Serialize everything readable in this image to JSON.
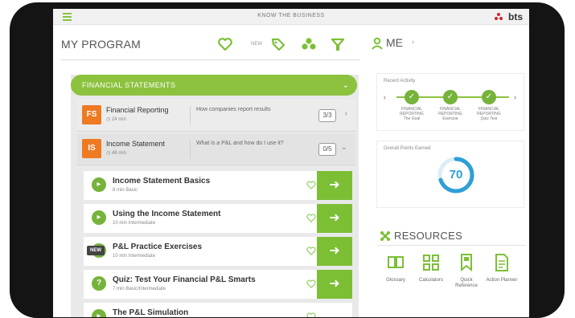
{
  "app": {
    "title": "KNOW THE BUSINESS",
    "brand": "bts"
  },
  "colors": {
    "accent": "#8cc23e",
    "accent_dark": "#76b33a",
    "topic_icon": "#ee7a22",
    "points": "#2f9fd6"
  },
  "program": {
    "title": "MY PROGRAM",
    "filter_new_label": "NEW",
    "section_label": "FINANCIAL STATEMENTS",
    "topics": [
      {
        "name": "Financial Reporting",
        "time": "24 min",
        "desc": "How companies report results",
        "count": "3/3",
        "icon": "FS"
      },
      {
        "name": "Income Statement",
        "time": "48 min",
        "desc": "What is a P&L and how do I use it?",
        "count": "0/5",
        "icon": "IS"
      }
    ],
    "lessons": [
      {
        "name": "Income Statement Basics",
        "meta": "8 min   Basic",
        "icon": "play-icon",
        "is_new": false
      },
      {
        "name": "Using the Income Statement",
        "meta": "10 min   Intermediate",
        "icon": "play-icon",
        "is_new": false
      },
      {
        "name": "P&L Practice Exercises",
        "meta": "10 min   Intermediate",
        "icon": "exercise-icon",
        "is_new": true,
        "new_label": "NEW"
      },
      {
        "name": "Quiz: Test Your Financial P&L Smarts",
        "meta": "7 min   Basic/Intermediate",
        "icon": "quiz-icon",
        "is_new": false
      },
      {
        "name": "The P&L Simulation",
        "meta": "",
        "icon": "play-icon",
        "is_new": false
      }
    ]
  },
  "me": {
    "label": "ME",
    "recent_activity_title": "Recent Activity",
    "activity": [
      {
        "label_line1": "FINANCIAL",
        "label_line2": "REPORTING",
        "label_line3": "The Goal"
      },
      {
        "label_line1": "FINANCIAL",
        "label_line2": "REPORTING",
        "label_line3": "Exercise"
      },
      {
        "label_line1": "FINANCIAL",
        "label_line2": "REPORTING",
        "label_line3": "Quiz Test"
      }
    ],
    "points_title": "Overall Points Earned",
    "points_value": "70",
    "points_fraction": 0.7
  },
  "resources": {
    "title": "RESOURCES",
    "items": [
      {
        "label": "Glossary",
        "icon": "book-icon"
      },
      {
        "label": "Calculators",
        "icon": "grid-icon"
      },
      {
        "label": "Quick Reference",
        "icon": "bookmark-icon"
      },
      {
        "label": "Action Planner",
        "icon": "document-icon"
      }
    ]
  }
}
